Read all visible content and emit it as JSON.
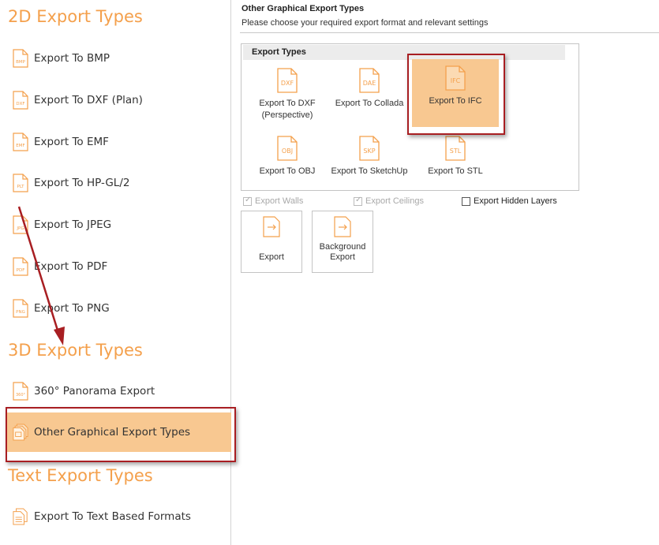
{
  "sidebar": {
    "sections": [
      {
        "title": "2D Export Types"
      },
      {
        "title": "3D Export Types"
      },
      {
        "title": "Text Export Types"
      }
    ],
    "items": [
      {
        "label": "Export To BMP",
        "badge": "BMP"
      },
      {
        "label": "Export To DXF (Plan)",
        "badge": "DXF"
      },
      {
        "label": "Export To EMF",
        "badge": "EMF"
      },
      {
        "label": "Export To HP-GL/2",
        "badge": "PLT"
      },
      {
        "label": "Export To JPEG",
        "badge": "JPG"
      },
      {
        "label": "Export To PDF",
        "badge": "PDF"
      },
      {
        "label": "Export To PNG",
        "badge": "PNG"
      },
      {
        "label": "360° Panorama Export",
        "badge": "360°"
      },
      {
        "label": "Other Graphical Export Types",
        "badge": ""
      },
      {
        "label": "Export To Text Based Formats",
        "badge": ""
      }
    ],
    "selected_index": 8
  },
  "panel": {
    "title": "Other Graphical Export Types",
    "subtitle": "Please choose your required export format and relevant settings",
    "group_title": "Export Types",
    "types": [
      {
        "label": "Export To DXF (Perspective)",
        "badge": "DXF"
      },
      {
        "label": "Export To Collada",
        "badge": "DAE"
      },
      {
        "label": "Export To IFC",
        "badge": "IFC"
      },
      {
        "label": "Export To OBJ",
        "badge": "OBJ"
      },
      {
        "label": "Export To SketchUp",
        "badge": "SKP"
      },
      {
        "label": "Export To STL",
        "badge": "STL"
      }
    ],
    "selected_type_index": 2,
    "options": [
      {
        "label": "Export Walls",
        "checked": true,
        "enabled": false
      },
      {
        "label": "Export Ceilings",
        "checked": true,
        "enabled": false
      },
      {
        "label": "Export Hidden Layers",
        "checked": false,
        "enabled": true
      }
    ],
    "buttons": [
      {
        "label": "Export"
      },
      {
        "label": "Background Export"
      }
    ]
  },
  "colors": {
    "accent": "#f4a04c",
    "selected_fill": "#f8c891",
    "highlight_border": "#a81e22"
  }
}
